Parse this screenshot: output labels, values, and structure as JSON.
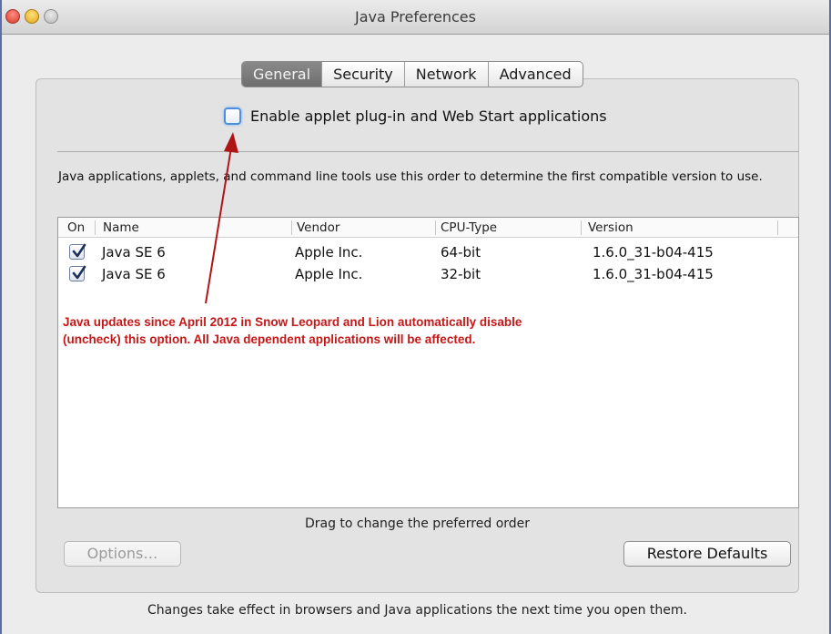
{
  "window": {
    "title": "Java Preferences",
    "controls": [
      "close",
      "minimize",
      "zoom"
    ]
  },
  "tabs": [
    {
      "label": "General",
      "active": true
    },
    {
      "label": "Security",
      "active": false
    },
    {
      "label": "Network",
      "active": false
    },
    {
      "label": "Advanced",
      "active": false
    }
  ],
  "enable_option": {
    "label": "Enable applet plug-in and Web Start applications",
    "checked": false
  },
  "description": "Java applications, applets, and command line tools use this order to determine the first compatible version to use.",
  "table": {
    "columns": [
      "On",
      "Name",
      "Vendor",
      "CPU-Type",
      "Version"
    ],
    "rows": [
      {
        "on": true,
        "name": "Java SE 6",
        "vendor": "Apple Inc.",
        "cpu": "64-bit",
        "version": "1.6.0_31-b04-415"
      },
      {
        "on": true,
        "name": "Java SE 6",
        "vendor": "Apple Inc.",
        "cpu": "32-bit",
        "version": "1.6.0_31-b04-415"
      }
    ]
  },
  "annotation": {
    "text": "Java updates since April 2012 in Snow Leopard and Lion automatically disable (uncheck) this option.  All Java dependent applications will be affected.",
    "color": "#c41818"
  },
  "drag_hint": "Drag to change the preferred order",
  "buttons": {
    "options": {
      "label": "Options…",
      "enabled": false
    },
    "restore": {
      "label": "Restore Defaults",
      "enabled": true
    }
  },
  "footer": "Changes take effect in browsers and Java applications the next time you open them.",
  "colors": {
    "accent": "#4c8fe0",
    "annotation_red": "#c41818",
    "active_tab": "#7a7a7a"
  }
}
